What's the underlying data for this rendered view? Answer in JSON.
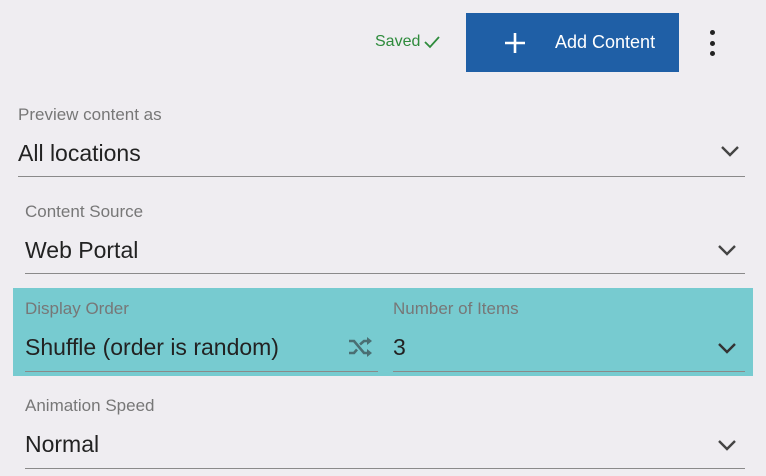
{
  "header": {
    "saved_label": "Saved",
    "add_button_label": "Add Content"
  },
  "fields": {
    "preview": {
      "label": "Preview content as",
      "value": "All locations"
    },
    "source": {
      "label": "Content Source",
      "value": "Web Portal"
    },
    "display_order": {
      "label": "Display Order",
      "value": "Shuffle (order is random)"
    },
    "number_of_items": {
      "label": "Number of Items",
      "value": "3"
    },
    "animation_speed": {
      "label": "Animation Speed",
      "value": "Normal"
    }
  },
  "colors": {
    "primary_button": "#1f5fa6",
    "saved_text": "#2e8b3c",
    "highlight": "#77cbd0",
    "background": "#efedf1"
  },
  "icons": [
    "checkmark-icon",
    "plus-icon",
    "more-vert-icon",
    "chevron-down-icon",
    "shuffle-icon"
  ]
}
